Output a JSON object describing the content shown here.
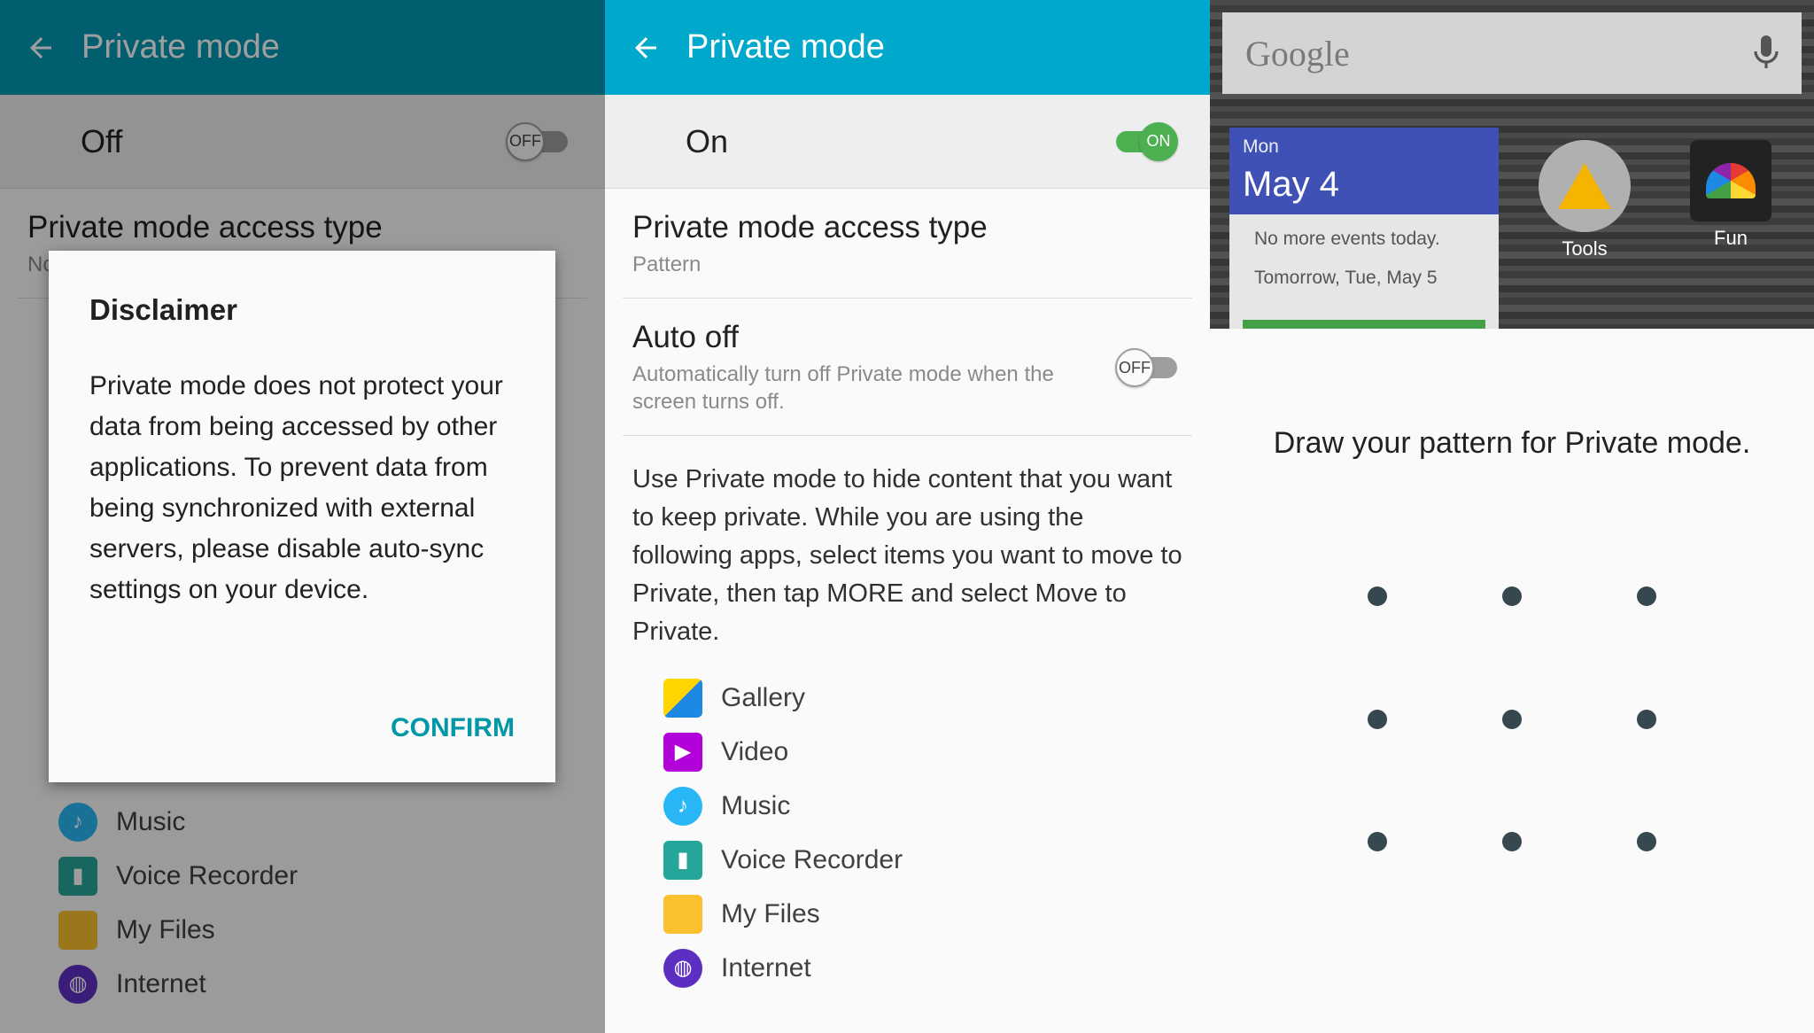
{
  "panel1": {
    "appbar": {
      "title": "Private mode"
    },
    "master": {
      "label": "Off",
      "switch_state": "OFF"
    },
    "bg_row": {
      "title": "Private mode access type",
      "subtitle": "No"
    },
    "dialog": {
      "title": "Disclaimer",
      "body": "Private mode does not protect your data from being accessed by other applications. To prevent data from being synchronized with external servers, please disable auto-sync settings on your device.",
      "confirm_label": "CONFIRM"
    },
    "apps": [
      {
        "name": "Music",
        "icon": "music-icon"
      },
      {
        "name": "Voice Recorder",
        "icon": "voice-recorder-icon"
      },
      {
        "name": "My Files",
        "icon": "my-files-icon"
      },
      {
        "name": "Internet",
        "icon": "internet-icon"
      }
    ]
  },
  "panel2": {
    "appbar": {
      "title": "Private mode"
    },
    "master": {
      "label": "On",
      "switch_state": "ON"
    },
    "access_type": {
      "title": "Private mode access type",
      "subtitle": "Pattern"
    },
    "auto_off": {
      "title": "Auto off",
      "subtitle": "Automatically turn off Private mode when the screen turns off.",
      "switch_state": "OFF"
    },
    "description": "Use Private mode to hide content that you want to keep private. While you are using the following apps, select items you want to move to Private, then tap MORE and select Move to Private.",
    "apps": [
      {
        "name": "Gallery",
        "icon": "gallery-icon"
      },
      {
        "name": "Video",
        "icon": "video-icon"
      },
      {
        "name": "Music",
        "icon": "music-icon"
      },
      {
        "name": "Voice Recorder",
        "icon": "voice-recorder-icon"
      },
      {
        "name": "My Files",
        "icon": "my-files-icon"
      },
      {
        "name": "Internet",
        "icon": "internet-icon"
      }
    ]
  },
  "panel3": {
    "search": {
      "logo": "Google",
      "icon": "microphone-icon"
    },
    "calendar": {
      "day": "Mon",
      "date": "May 4",
      "event1": "No more events today.",
      "event2": "Tomorrow, Tue, May 5"
    },
    "shortcuts": [
      {
        "label": "Tools",
        "icon": "tools-folder-icon"
      },
      {
        "label": "Fun",
        "icon": "fun-folder-icon"
      }
    ],
    "pattern_prompt": "Draw your pattern for Private mode."
  },
  "colors": {
    "appbar_dim": "#0098b4",
    "appbar": "#00a8cc",
    "switch_on": "#4caf50",
    "confirm": "#0097a7",
    "pattern_dot": "#37474f"
  }
}
